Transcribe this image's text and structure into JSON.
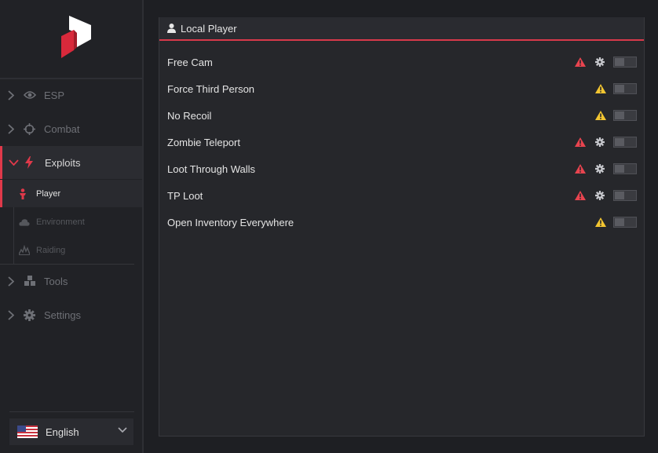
{
  "sidebar": {
    "nav": [
      {
        "label": "ESP",
        "icon": "eye-icon"
      },
      {
        "label": "Combat",
        "icon": "crosshair-icon"
      },
      {
        "label": "Exploits",
        "icon": "lightning-icon"
      },
      {
        "label": "Tools",
        "icon": "cubes-icon"
      },
      {
        "label": "Settings",
        "icon": "gear-icon"
      }
    ],
    "subitems": [
      {
        "label": "Player",
        "icon": "person-icon"
      },
      {
        "label": "Environment",
        "icon": "cloud-icon"
      },
      {
        "label": "Raiding",
        "icon": "explosion-icon"
      }
    ],
    "language": {
      "label": "English",
      "flag": "us-flag-icon"
    }
  },
  "panel": {
    "title": "Local Player",
    "title_icon": "user-icon",
    "rows": [
      {
        "label": "Free Cam",
        "warning": "red",
        "settings": true,
        "enabled": false
      },
      {
        "label": "Force Third Person",
        "warning": "yellow",
        "settings": false,
        "enabled": false
      },
      {
        "label": "No Recoil",
        "warning": "yellow",
        "settings": false,
        "enabled": false
      },
      {
        "label": "Zombie Teleport",
        "warning": "red",
        "settings": true,
        "enabled": false
      },
      {
        "label": "Loot Through Walls",
        "warning": "red",
        "settings": true,
        "enabled": false
      },
      {
        "label": "TP Loot",
        "warning": "red",
        "settings": true,
        "enabled": false
      },
      {
        "label": "Open Inventory Everywhere",
        "warning": "yellow",
        "settings": false,
        "enabled": false
      }
    ]
  },
  "colors": {
    "accent": "#e0394a",
    "warning_red": "#e8444f",
    "warning_yellow": "#f2c531"
  }
}
